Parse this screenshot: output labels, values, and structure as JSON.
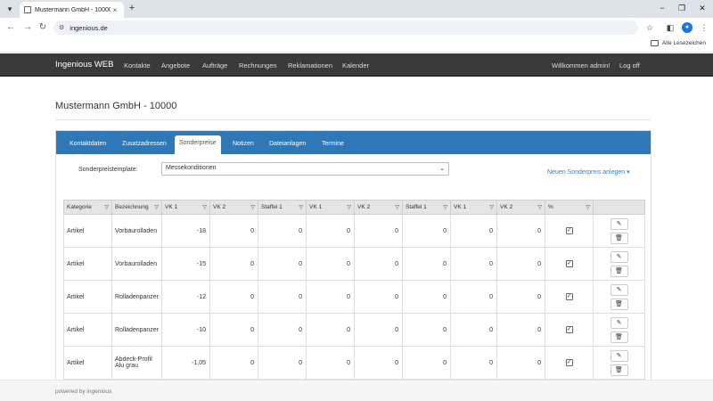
{
  "browser": {
    "tab_title": "Mustermann GmbH - 10000 - I",
    "tab_close": "×",
    "new_tab": "+",
    "url": "ingenious.de",
    "bookmark_folder": "Alle Lesezeichen",
    "minimize": "−",
    "maximize": "❐",
    "close": "✕",
    "profile": "●"
  },
  "nav": {
    "brand": "Ingenious WEB",
    "items": [
      "Kontakte",
      "Angebote",
      "Aufträge",
      "Rechnungen",
      "Reklamationen",
      "Kalender"
    ],
    "welcome": "Willkommen admin!",
    "logoff": "Log off"
  },
  "page": {
    "title": "Mustermann GmbH - 10000"
  },
  "tabs": {
    "items": [
      "Kontaktdaten",
      "Zusatzadressen",
      "Sonderpreise",
      "Notizen",
      "Dateianlagen",
      "Termine"
    ],
    "active": "Sonderpreise"
  },
  "template": {
    "label": "Sonderpreistemplate:",
    "value": "Messekonditionen",
    "new_link": "Neuen Sonderpreis anlegen ▾"
  },
  "table": {
    "headers": [
      "Kategorie",
      "Bezeichnung",
      "VK 1",
      "VK 2",
      "Staffel 1",
      "VK 1",
      "VK 2",
      "Staffel 1",
      "VK 1",
      "VK 2",
      "%"
    ],
    "rows": [
      {
        "kategorie": "Artikel",
        "bezeichnung": "Vorbaurolladen",
        "vk1": "-18",
        "vk2": "0",
        "staffel1": "0",
        "vk1b": "0",
        "vk2b": "0",
        "staffel1b": "0",
        "vk1c": "0",
        "vk2c": "0",
        "pct": "✓"
      },
      {
        "kategorie": "Artikel",
        "bezeichnung": "Vorbaurolladen",
        "vk1": "-15",
        "vk2": "0",
        "staffel1": "0",
        "vk1b": "0",
        "vk2b": "0",
        "staffel1b": "0",
        "vk1c": "0",
        "vk2c": "0",
        "pct": "✓"
      },
      {
        "kategorie": "Artikel",
        "bezeichnung": "Rolladenpanzer",
        "vk1": "-12",
        "vk2": "0",
        "staffel1": "0",
        "vk1b": "0",
        "vk2b": "0",
        "staffel1b": "0",
        "vk1c": "0",
        "vk2c": "0",
        "pct": "✓"
      },
      {
        "kategorie": "Artikel",
        "bezeichnung": "Rolladenpanzer",
        "vk1": "-10",
        "vk2": "0",
        "staffel1": "0",
        "vk1b": "0",
        "vk2b": "0",
        "staffel1b": "0",
        "vk1c": "0",
        "vk2c": "0",
        "pct": "✓"
      },
      {
        "kategorie": "Artikel",
        "bezeichnung": "Abdeck-Profil Alu grau",
        "vk1": "-1,05",
        "vk2": "0",
        "staffel1": "0",
        "vk1b": "0",
        "vk2b": "0",
        "staffel1b": "0",
        "vk1c": "0",
        "vk2c": "0",
        "pct": "✓"
      }
    ],
    "filter_glyph": "▽",
    "edit_glyph": "✎",
    "delete_glyph": "🗑"
  },
  "footer": {
    "text": "powered by ingenious"
  }
}
